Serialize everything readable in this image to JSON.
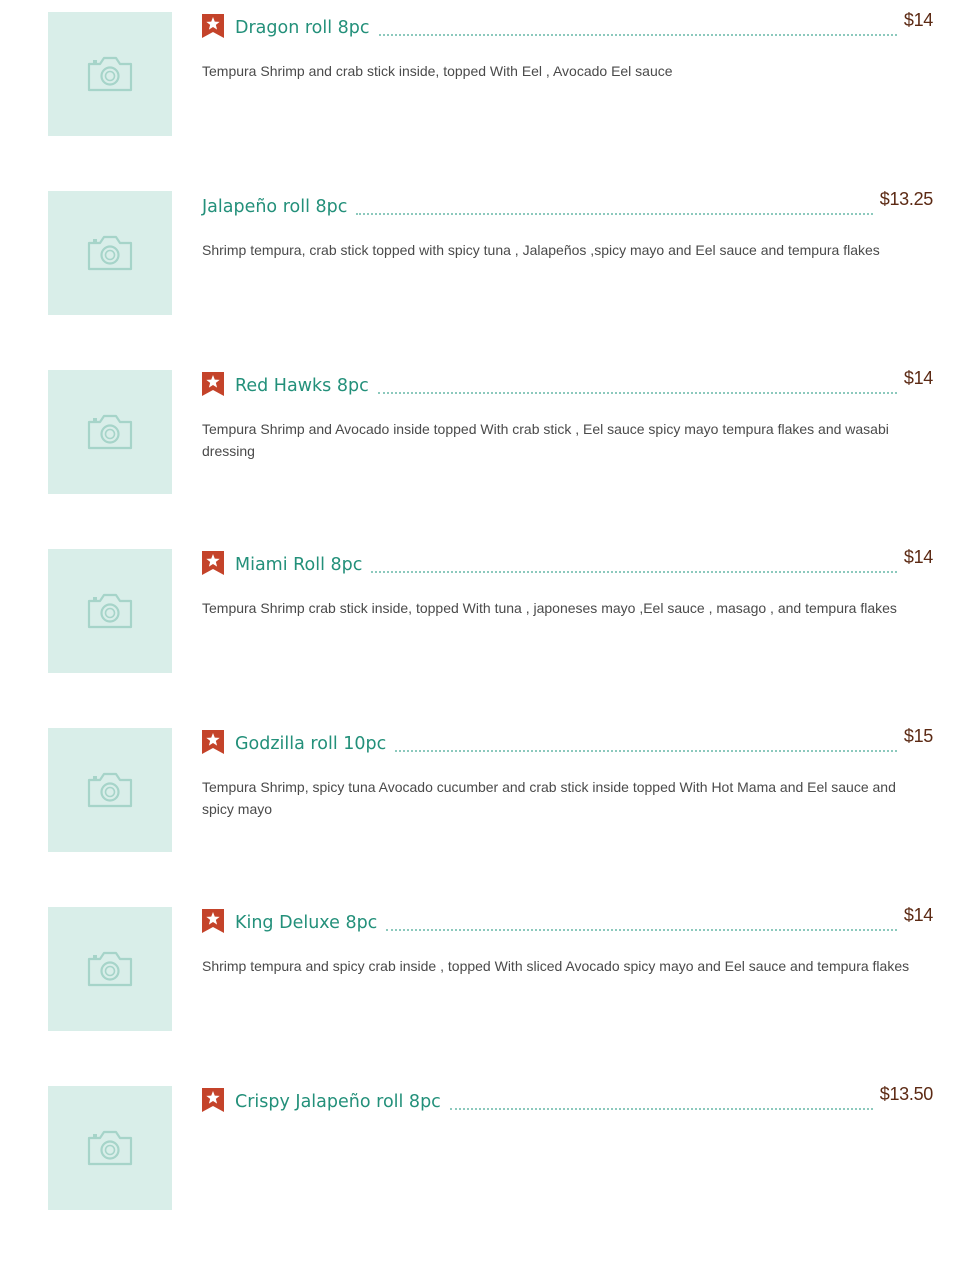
{
  "colors": {
    "thumbnail_bg": "#d9eee9",
    "camera_icon": "#a6d4c9",
    "item_name": "#23907a",
    "price": "#5c2a14",
    "description": "#4a4a4a",
    "badge": "#c4432a",
    "leader_dots": "#8cc9bd"
  },
  "items": [
    {
      "name": "Dragon roll 8pc",
      "price": "$14",
      "description": "Tempura Shrimp and crab stick inside, topped With Eel , Avocado Eel sauce",
      "badge": "star-badge-icon",
      "image": "camera-placeholder-icon"
    },
    {
      "name": "Jalapeño roll 8pc",
      "price": "$13.25",
      "description": "Shrimp tempura, crab stick topped with spicy tuna , Jalapeños ,spicy mayo and Eel sauce and tempura flakes",
      "badge": null,
      "image": "camera-placeholder-icon"
    },
    {
      "name": "Red Hawks 8pc",
      "price": "$14",
      "description": "Tempura Shrimp and Avocado inside topped With crab stick , Eel sauce spicy mayo tempura flakes and wasabi dressing",
      "badge": "star-badge-icon",
      "image": "camera-placeholder-icon"
    },
    {
      "name": "Miami Roll 8pc",
      "price": "$14",
      "description": "Tempura Shrimp crab stick inside, topped With tuna , japoneses mayo ,Eel sauce , masago , and tempura flakes",
      "badge": "star-badge-icon",
      "image": "camera-placeholder-icon"
    },
    {
      "name": " Godzilla roll 10pc",
      "price": "$15",
      "description": "Tempura Shrimp, spicy tuna Avocado cucumber and crab stick inside topped With Hot Mama and Eel sauce and spicy mayo",
      "badge": "star-badge-icon",
      "image": "camera-placeholder-icon"
    },
    {
      "name": "King Deluxe 8pc",
      "price": "$14",
      "description": "Shrimp tempura and spicy crab inside , topped With sliced Avocado spicy mayo and Eel sauce and tempura flakes",
      "badge": "star-badge-icon",
      "image": "camera-placeholder-icon"
    },
    {
      "name": "Crispy Jalapeño roll 8pc",
      "price": "$13.50",
      "description": "",
      "badge": "star-badge-icon",
      "image": "camera-placeholder-icon"
    }
  ]
}
